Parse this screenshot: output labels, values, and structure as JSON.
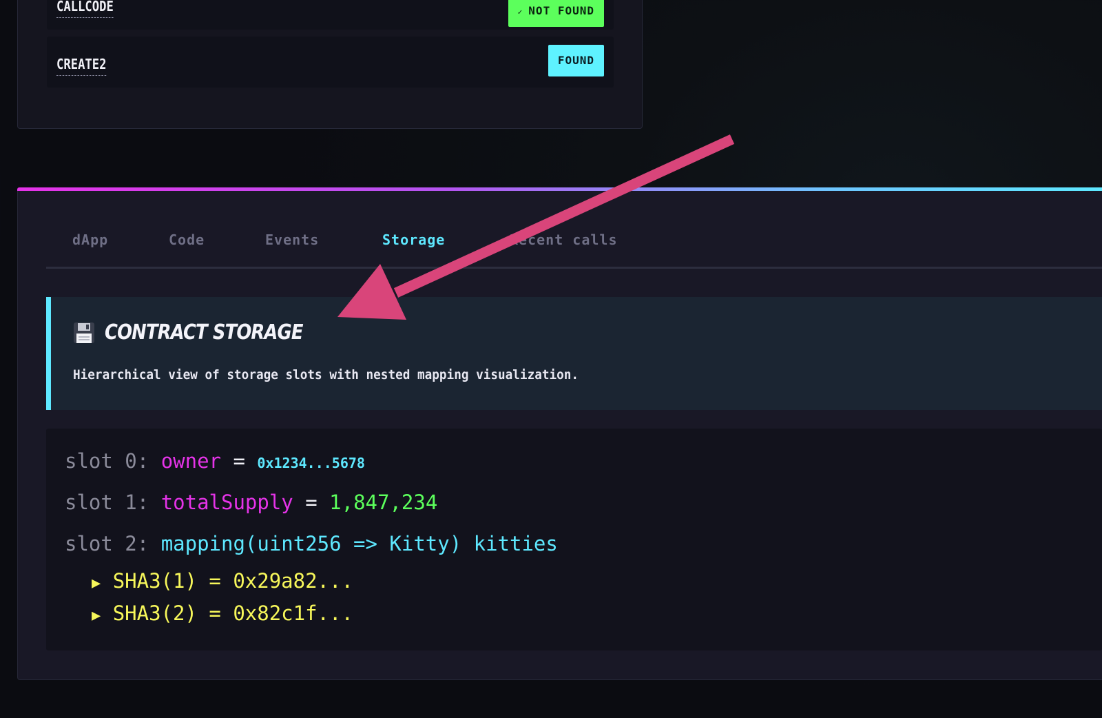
{
  "opcodes": [
    {
      "name": "CALLCODE",
      "status": "NOT FOUND",
      "status_icon": "check-icon",
      "status_color": "#5cff5c"
    },
    {
      "name": "CREATE2",
      "status": "FOUND",
      "status_color": "#5ef2ff"
    }
  ],
  "tabs": [
    {
      "label": "dApp",
      "active": false
    },
    {
      "label": "Code",
      "active": false
    },
    {
      "label": "Events",
      "active": false
    },
    {
      "label": "Storage",
      "active": true
    },
    {
      "label": "Recent calls",
      "active": false
    }
  ],
  "info": {
    "icon": "floppy-disk-icon",
    "title": "Contract Storage",
    "description": "Hierarchical view of storage slots with nested mapping visualization."
  },
  "storage": {
    "slots": [
      {
        "label": "slot 0:",
        "name": "owner",
        "eq": "=",
        "value": "0x1234...5678"
      },
      {
        "label": "slot 1:",
        "name": "totalSupply",
        "eq": "=",
        "value": "1,847,234"
      },
      {
        "label": "slot 2:",
        "declaration": "mapping(uint256 => Kitty) kitties"
      }
    ],
    "entries": [
      {
        "marker": "▶",
        "text": "SHA3(1) = 0x29a82..."
      },
      {
        "marker": "▶",
        "text": "SHA3(2) = 0x82c1f..."
      }
    ]
  },
  "colors": {
    "accent_cyan": "#5ee8ff",
    "accent_magenta": "#e533e8",
    "accent_green": "#5cff5c",
    "accent_yellow": "#f7f75a",
    "annotation_arrow": "#d9457a"
  }
}
